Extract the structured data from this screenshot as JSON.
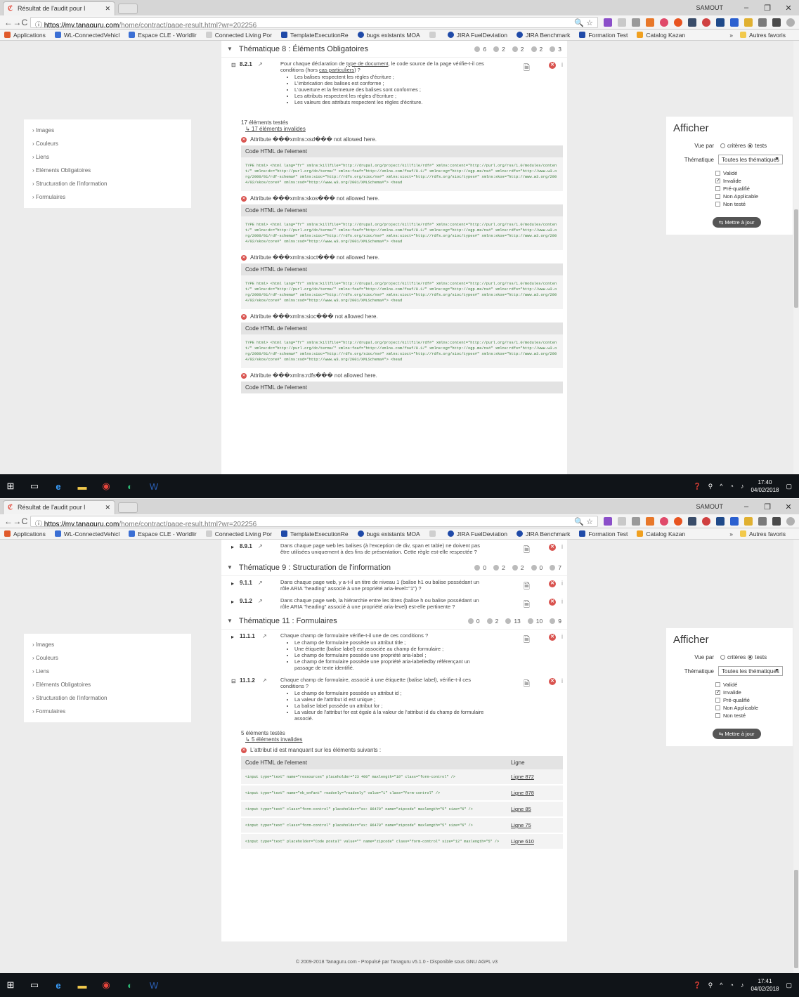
{
  "browser": {
    "tab_title": "Résultat de l'audit pour l",
    "tab_close": "✕",
    "user": "SAMOUT",
    "win_min": "–",
    "win_max": "❐",
    "win_close": "✕",
    "back": "←",
    "forward": "→",
    "reload": "C",
    "url_host": "https://my.tanaguru.com",
    "url_path": "/home/contract/page-result.html?wr=202256",
    "url_secure_icon": "ⓘ",
    "omni_icons": "🔍 ☆",
    "bookmarks": [
      {
        "label": "Applications",
        "color": "#e05a2b"
      },
      {
        "label": "WL-ConnectedVehicl",
        "color": "#3b6fd4"
      },
      {
        "label": "Espace CLE - Worldlir",
        "color": "#3b6fd4"
      },
      {
        "label": "Connected Living Por",
        "color": "#cfcfcf"
      },
      {
        "label": "TemplateExecutionRe",
        "color": "#1f4aa8"
      },
      {
        "label": "bugs existants MOA",
        "color": "#1f4aa8"
      },
      {
        "label": "",
        "color": "#cfcfcf"
      },
      {
        "label": "JIRA FuelDeviation",
        "color": "#1f4aa8"
      },
      {
        "label": "JIRA Benchmark",
        "color": "#1f4aa8"
      },
      {
        "label": "Formation Test",
        "color": "#1f4aa8"
      },
      {
        "label": "Catalog Kazan",
        "color": "#f0a020"
      }
    ],
    "bookmarks_more": "»",
    "other_bookmarks": "Autres favoris"
  },
  "left_menu": {
    "items": [
      "Images",
      "Couleurs",
      "Liens",
      "Eléments Obligatoires",
      "Structuration de l'information",
      "Formulaires"
    ]
  },
  "filters": {
    "title": "Afficher",
    "view_label": "Vue par",
    "view_criteres": "critères",
    "view_tests": "tests",
    "theme_label": "Thématique",
    "theme_selected": "Toutes les thématiques",
    "checks": [
      {
        "label": "Validé",
        "checked": false
      },
      {
        "label": "Invalide",
        "checked": true
      },
      {
        "label": "Pré-qualifié",
        "checked": false
      },
      {
        "label": "Non Applicable",
        "checked": false
      },
      {
        "label": "Non testé",
        "checked": false
      }
    ],
    "update_btn": "Mettre à jour",
    "update_icon": "⇆"
  },
  "shot1": {
    "theme8": {
      "title": "Thématique 8 : Éléments Obligatoires",
      "counts": [
        "6",
        "2",
        "2",
        "2",
        "3"
      ]
    },
    "crit821": {
      "num": "8.2.1",
      "text_pre": "Pour chaque déclaration de ",
      "text_link": "type de document",
      "text_post": ", le code source de la page vérifie-t-il ces conditions (hors ",
      "text_link2": "cas particuliers",
      "text_end": ") ?",
      "subs": [
        "Les balises respectent les règles d'écriture ;",
        "L'imbrication des balises est conforme ;",
        "L'ouverture et la fermeture des balises sont conformes ;",
        "Les attributs respectent les règles d'écriture ;",
        "Les valeurs des attributs respectent les règles d'écriture."
      ]
    },
    "tested": "17 éléments testés",
    "invalid": "17 éléments invalides",
    "errors": [
      "Attribute ���xmlns:xsd��� not allowed here.",
      "Attribute ���xmlns:skos��� not allowed here.",
      "Attribute ���xmlns:sioct��� not allowed here.",
      "Attribute ���xmlns:sioc��� not allowed here.",
      "Attribute ���xmlns:rdfs��� not allowed here."
    ],
    "code_head": "Code HTML de l'element",
    "code_text": "TYPE html> <html lang=\"fr\" xmlns:killfile=\"http://drupal.org/project/killfile/rdf#\" xmlns:content=\"http://purl.org/rss/1.0/modules/content/\" xmlns:dc=\"http://purl.org/dc/terms/\" xmlns:foaf=\"http://xmlns.com/foaf/0.1/\" xmlns:og=\"http://ogp.me/ns#\" xmlns:rdfs=\"http://www.w3.org/2000/01/rdf-schema#\" xmlns:sioc=\"http://rdfs.org/sioc/ns#\" xmlns:sioct=\"http://rdfs.org/sioc/types#\" xmlns:skos=\"http://www.w3.org/2004/02/skos/core#\" xmlns:xsd=\"http://www.w3.org/2001/XMLSchema#\"> <head"
  },
  "shot2": {
    "crit891": {
      "num": "8.9.1",
      "text": "Dans chaque page web les balises (à l'exception de div, span et table) ne doivent pas être utilisées uniquement à des fins de présentation. Cette règle est-elle respectée ?"
    },
    "theme9": {
      "title": "Thématique 9 : Structuration de l'information",
      "counts": [
        "0",
        "2",
        "2",
        "0",
        "7"
      ]
    },
    "crit911": {
      "num": "9.1.1",
      "text": "Dans chaque page web, y a-t-il un titre de niveau 1 (balise h1 ou balise possédant un rôle ARIA \"heading\" associé à une propriété aria-level=\"1\") ?"
    },
    "crit912": {
      "num": "9.1.2",
      "text": "Dans chaque page web, la hiérarchie entre les titres (balise h ou balise possédant un rôle ARIA \"heading\" associé à une propriété aria-level) est-elle pertinente ?"
    },
    "theme11": {
      "title": "Thématique 11 : Formulaires",
      "counts": [
        "0",
        "2",
        "13",
        "10",
        "9"
      ]
    },
    "crit1111": {
      "num": "11.1.1",
      "text": "Chaque champ de formulaire vérifie-t-il une de ces conditions ?",
      "subs": [
        "Le champ de formulaire possède un attribut title ;",
        "Une étiquette (balise label) est associée au champ de formulaire ;",
        "Le champ de formulaire possède une propriété aria-label ;",
        "Le champ de formulaire possède une propriété aria-labelledby référençant un passage de texte identifié."
      ]
    },
    "crit1112": {
      "num": "11.1.2",
      "text": "Chaque champ de formulaire, associé à une étiquette (balise label), vérifie-t-il ces conditions ?",
      "subs": [
        "Le champ de formulaire possède un attribut id ;",
        "La valeur de l'attribut id est unique ;",
        "La balise label possède un attribut for ;",
        "La valeur de l'attribut for est égale à la valeur de l'attribut id du champ de formulaire associé."
      ]
    },
    "tested": "5 éléments testés",
    "invalid": "5 éléments invalides",
    "error": "L'attribut id est manquant sur les éléments suivants :",
    "table_head_code": "Code HTML de l'element",
    "table_head_line": "Ligne",
    "rows": [
      {
        "code": "<input type=\"text\" name=\"ressources\" placeholder=\"23 400\" maxlength=\"10\" class=\"form-control\" />",
        "line": "Ligne 872"
      },
      {
        "code": "<input type=\"text\" name=\"nb_enfant\" readonly=\"readonly\" value=\"1\" class=\"form-control\" />",
        "line": "Ligne 878"
      },
      {
        "code": "<input type=\"text\" class=\"form-control\" placeholder=\"ex: 86470\" name=\"zipcode\" maxlength=\"5\" size=\"6\" />",
        "line": "Ligne 85"
      },
      {
        "code": "<input type=\"text\" class=\"form-control\" placeholder=\"ex: 86470\" name=\"zipcode\" maxlength=\"5\" size=\"6\" />",
        "line": "Ligne 75"
      },
      {
        "code": "<input type=\"text\" placeholder=\"Code postal\" value=\"\" name=\"zipcode\" class=\"form-control\" size=\"12\" maxlength=\"5\" />",
        "line": "Ligne 610"
      }
    ],
    "footer": "© 2009-2018 Tanaguru.com - Propulsé par Tanaguru v5.1.0 - Disponible sous GNU AGPL v3"
  },
  "taskbar": {
    "time1": "17:40",
    "date1": "04/02/2018",
    "time2": "17:41",
    "date2": "04/02/2018"
  }
}
